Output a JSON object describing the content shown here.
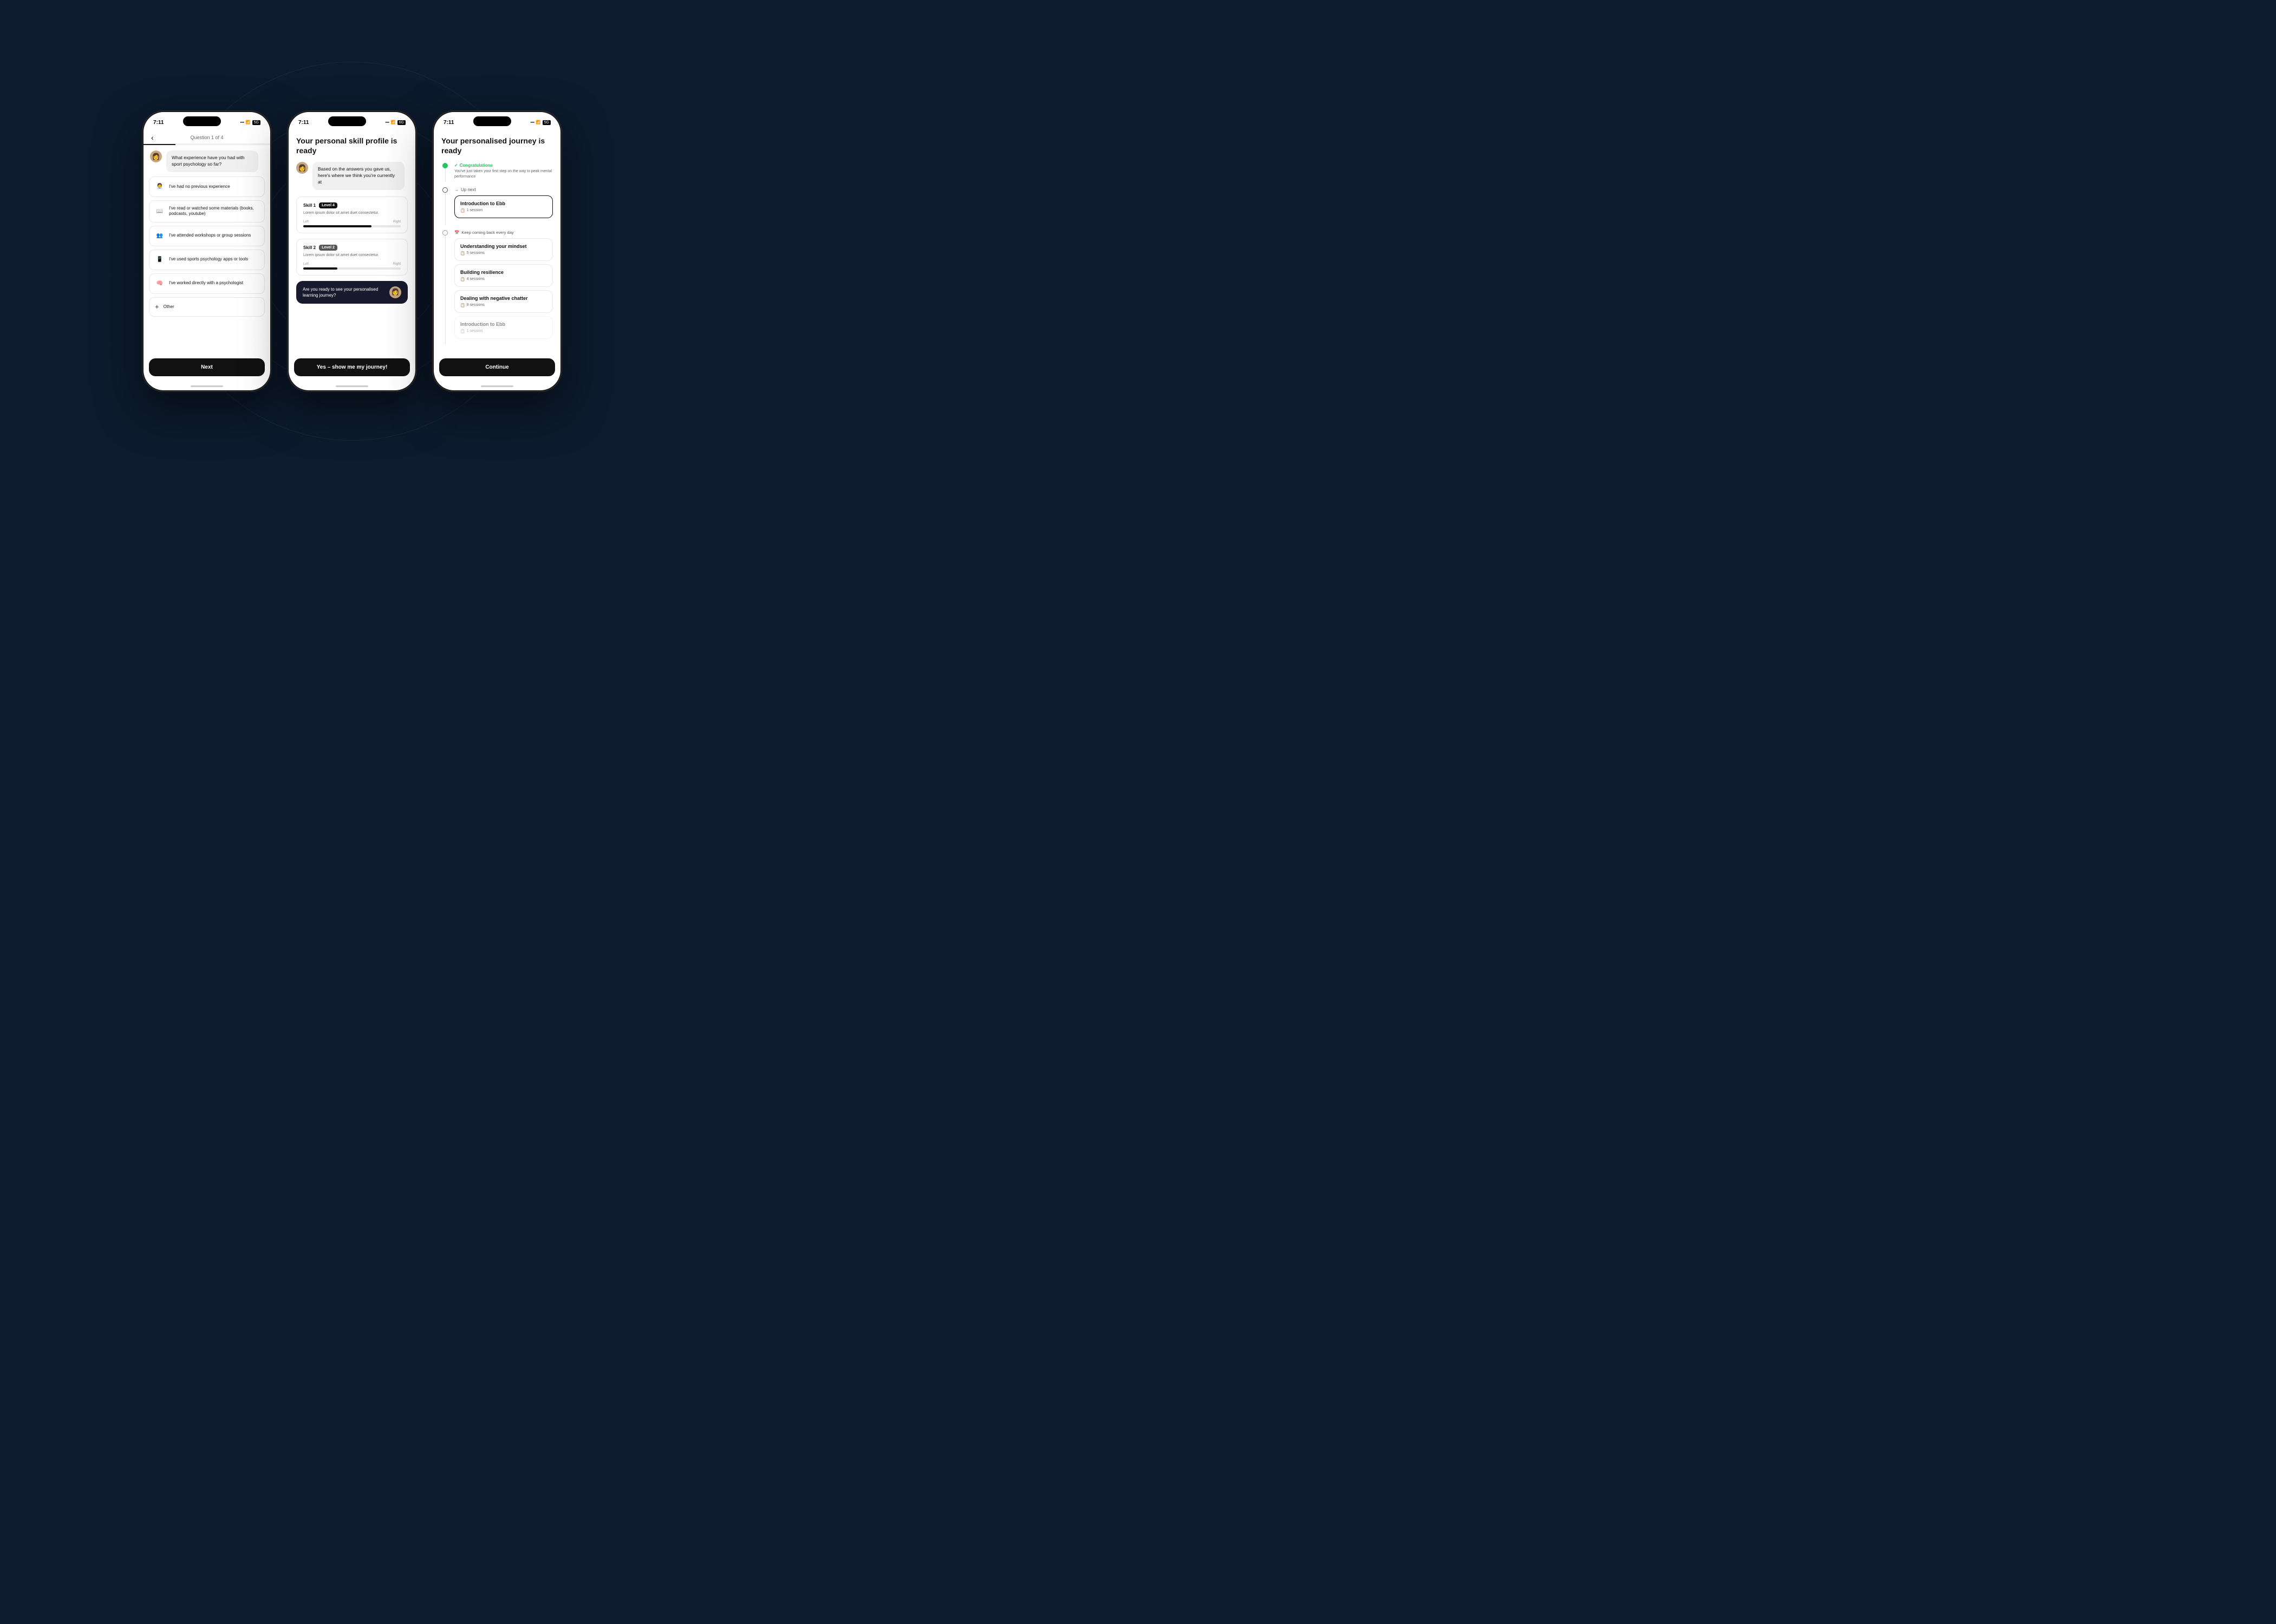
{
  "background": {
    "color": "#0d1b2e"
  },
  "phone1": {
    "status_time": "7:11",
    "header_label": "Question 1 of 4",
    "question": "What experience have you had with sport psychology so far?",
    "options": [
      {
        "icon": "🧑‍💼",
        "text": "I've had no previous experience"
      },
      {
        "icon": "📖",
        "text": "I've read or watched some materials (books, podcasts, youtube)"
      },
      {
        "icon": "👥",
        "text": "I've attended workshops or group sessions"
      },
      {
        "icon": "📱",
        "text": "I've used sports psychology apps or tools"
      },
      {
        "icon": "🧠",
        "text": "I've worked directly with a psychologist"
      }
    ],
    "other_label": "Other",
    "next_button": "Next"
  },
  "phone2": {
    "status_time": "7:11",
    "title": "Your personal skill profile is ready",
    "chat_text": "Based on the answers you gave us, here's where we think you're currently at",
    "skill1": {
      "label": "Skill 1",
      "level": "Level 4",
      "level_class": "level-4",
      "desc": "Lorem ipsum dolor sit amet duet consectetur.",
      "bar_width": "70%"
    },
    "skill2": {
      "label": "Skill 2",
      "level": "Level 2",
      "level_class": "level-2",
      "desc": "Lorem ipsum dolor sit amet duet consectetur.",
      "bar_width": "35%"
    },
    "ready_text": "Are you ready to see your personalised learning journey?",
    "cta_button": "Yes – show me my journey!"
  },
  "phone3": {
    "status_time": "7:11",
    "title": "Your personalised journey is ready",
    "congrats_label": "Congratulations",
    "congrats_desc": "You've just taken your first step on the way to peak mental performance",
    "up_next_label": "Up next",
    "intro_card": {
      "title": "Introduction to Ebb",
      "sessions": "1 session"
    },
    "keep_label": "Keep coming back every day",
    "journey_cards": [
      {
        "title": "Understanding your mindset",
        "sessions": "5 sessions"
      },
      {
        "title": "Building resilience",
        "sessions": "4 sessions"
      },
      {
        "title": "Dealing with negative chatter",
        "sessions": "8 sessions"
      },
      {
        "title": "Introduction to Ebb",
        "sessions": "1 session"
      }
    ],
    "continue_button": "Continue"
  }
}
